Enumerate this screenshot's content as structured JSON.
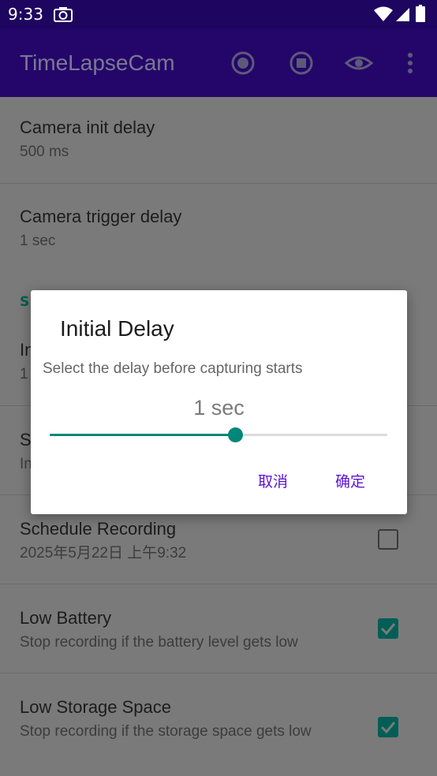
{
  "status_bar": {
    "time": "9:33"
  },
  "app_bar": {
    "title": "TimeLapseCam",
    "icons": [
      "record-icon",
      "stop-icon",
      "preview-eye-icon",
      "more-vert-icon"
    ]
  },
  "settings": {
    "camera_init_delay": {
      "title": "Camera init delay",
      "summary": "500 ms"
    },
    "camera_trigger_delay": {
      "title": "Camera trigger delay",
      "summary": "1 sec"
    },
    "section_header_partial": "S",
    "initial_delay_partial": {
      "title": "In",
      "summary": "1"
    },
    "item4_partial": {
      "title": "S",
      "summary": "In"
    },
    "schedule_recording": {
      "title": "Schedule Recording",
      "summary": "2025年5月22日 上午9:32",
      "checked": false
    },
    "low_battery": {
      "title": "Low Battery",
      "summary": "Stop recording if the battery level gets low",
      "checked": true
    },
    "low_storage": {
      "title": "Low Storage Space",
      "summary": "Stop recording if the storage space gets low",
      "checked": true
    }
  },
  "dialog": {
    "title": "Initial Delay",
    "message": "Select the delay before capturing starts",
    "value": "1 sec",
    "slider_fraction": 0.55,
    "cancel_label": "取消",
    "ok_label": "确定"
  },
  "colors": {
    "status_bar": "#1e0560",
    "app_bar": "#24066a",
    "accent": "#00877a",
    "button_text": "#5c13d6"
  }
}
